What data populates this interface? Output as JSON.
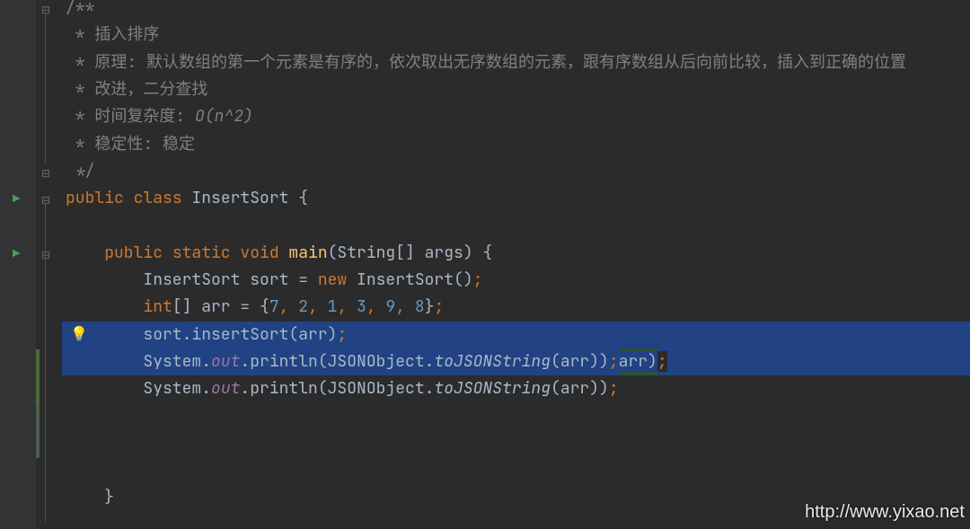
{
  "lines": {
    "l0": "/**",
    "l1_a": " * ",
    "l1_b": "插入排序",
    "l2": " * 原理: 默认数组的第一个元素是有序的，依次取出无序数组的元素，跟有序数组从后向前比较，插入到正确的位置",
    "l3": " * 改进，二分查找",
    "l4_a": " * 时间复杂度: ",
    "l4_b": "O(n^2)",
    "l5": " * 稳定性: 稳定",
    "l6": " */",
    "l7_public": "public ",
    "l7_class": "class ",
    "l7_name": "InsertSort ",
    "l7_brace": "{",
    "l9_public": "public ",
    "l9_static": "static ",
    "l9_void": "void ",
    "l9_main": "main",
    "l9_sig": "(String[] args) {",
    "l10_a": "InsertSort sort = ",
    "l10_new": "new ",
    "l10_b": "InsertSort()",
    "l10_semi": ";",
    "l11_int": "int",
    "l11_a": "[] arr = {",
    "l11_n1": "7",
    "l11_n2": "2",
    "l11_n3": "1",
    "l11_n4": "3",
    "l11_n5": "9",
    "l11_n6": "8",
    "l11_c": ", ",
    "l11_close": "}",
    "l11_semi": ";",
    "l12_a": "sort.insertSort(",
    "l12_b": "arr",
    "l12_c": ")",
    "l12_semi": ";",
    "l13_sys": "System.",
    "l13_out": "out",
    "l13_pr": ".println(JSONObject.",
    "l13_tj": "toJSONString",
    "l13_op": "(arr))",
    "l13_semi": ";",
    "l13_extra": "arr)",
    "l13_semi2": ";",
    "l14_sys": "System.",
    "l14_out": "out",
    "l14_pr": ".println(JSONObject.",
    "l14_tj": "toJSONString",
    "l14_op": "(arr))",
    "l14_semi": ";",
    "l17_brace": "}"
  },
  "icons": {
    "run": "▶",
    "bulb": "💡",
    "fold_minus": "⊟"
  },
  "watermark": "http://www.yixao.net"
}
